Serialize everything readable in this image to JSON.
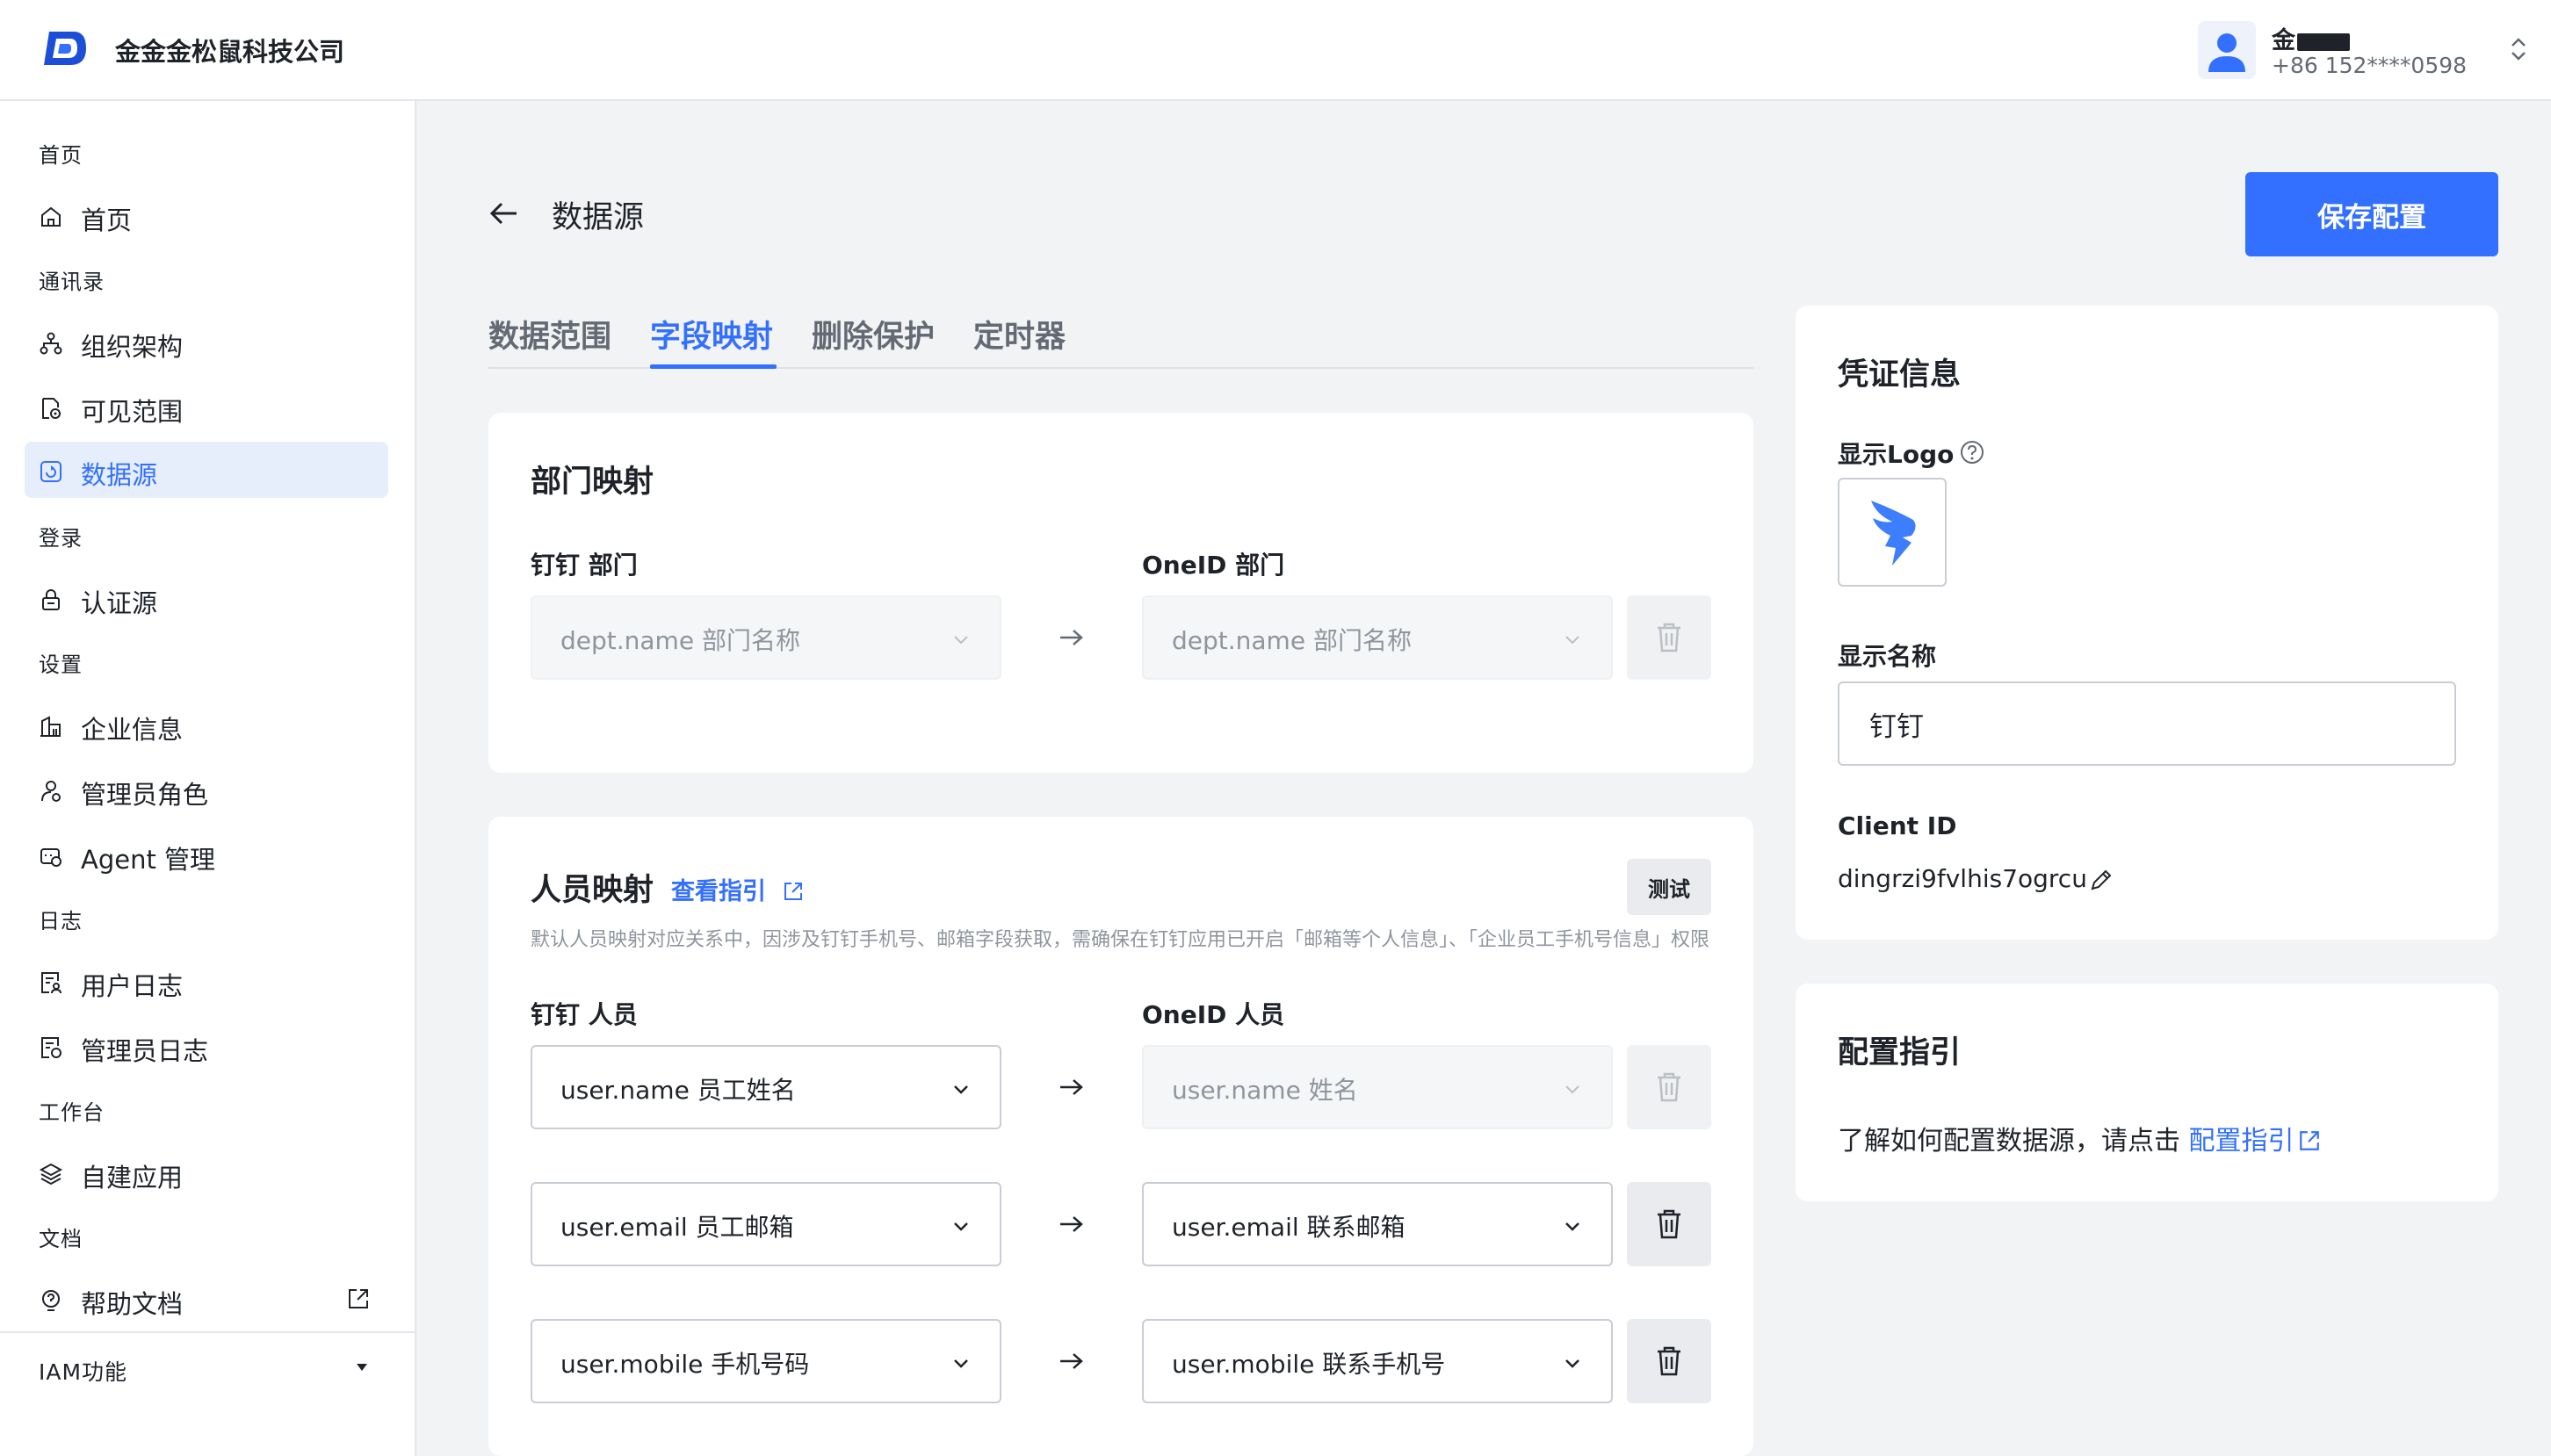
{
  "header": {
    "company": "金金金松鼠科技公司",
    "user_name": "金",
    "user_phone": "+86 152****0598"
  },
  "sidebar": {
    "groups": [
      "首页",
      "通讯录",
      "登录",
      "设置",
      "日志",
      "工作台",
      "文档"
    ],
    "items": [
      {
        "label": "首页",
        "icon": "home-icon"
      },
      {
        "label": "组织架构",
        "icon": "org-icon"
      },
      {
        "label": "可见范围",
        "icon": "file-eye-icon"
      },
      {
        "label": "数据源",
        "icon": "datasource-icon",
        "active": true
      },
      {
        "label": "认证源",
        "icon": "lock-icon"
      },
      {
        "label": "企业信息",
        "icon": "building-icon"
      },
      {
        "label": "管理员角色",
        "icon": "admin-role-icon"
      },
      {
        "label": "Agent 管理",
        "icon": "agent-icon"
      },
      {
        "label": "用户日志",
        "icon": "user-log-icon"
      },
      {
        "label": "管理员日志",
        "icon": "admin-log-icon"
      },
      {
        "label": "自建应用",
        "icon": "layers-icon"
      },
      {
        "label": "帮助文档",
        "icon": "help-icon"
      }
    ],
    "iam": "IAM功能"
  },
  "page": {
    "title": "数据源",
    "save_label": "保存配置"
  },
  "tabs": [
    "数据范围",
    "字段映射",
    "删除保护",
    "定时器"
  ],
  "active_tab": "字段映射",
  "dept_mapping": {
    "title": "部门映射",
    "left_label": "钉钉 部门",
    "right_label": "OneID 部门",
    "left_value": "dept.name 部门名称",
    "right_value": "dept.name 部门名称"
  },
  "user_mapping": {
    "title": "人员映射",
    "guide_link": "查看指引",
    "test_label": "测试",
    "hint": "默认人员映射对应关系中，因涉及钉钉手机号、邮箱字段获取，需确保在钉钉应用已开启「邮箱等个人信息」、「企业员工手机号信息」权限",
    "left_label": "钉钉 人员",
    "right_label": "OneID 人员",
    "rows": [
      {
        "left": "user.name 员工姓名",
        "right": "user.name 姓名"
      },
      {
        "left": "user.email 员工邮箱",
        "right": "user.email 联系邮箱"
      },
      {
        "left": "user.mobile 手机号码",
        "right": "user.mobile 联系手机号"
      }
    ]
  },
  "credential": {
    "title": "凭证信息",
    "logo_label": "显示Logo",
    "name_label": "显示名称",
    "name_value": "钉钉",
    "client_id_label": "Client ID",
    "client_id_value": "dingrzi9fvlhis7ogrcu"
  },
  "guide": {
    "title": "配置指引",
    "text": "了解如何配置数据源，请点击",
    "link": "配置指引"
  },
  "colors": {
    "primary": "#3370ff",
    "dingtalk": "#3d7eff"
  }
}
